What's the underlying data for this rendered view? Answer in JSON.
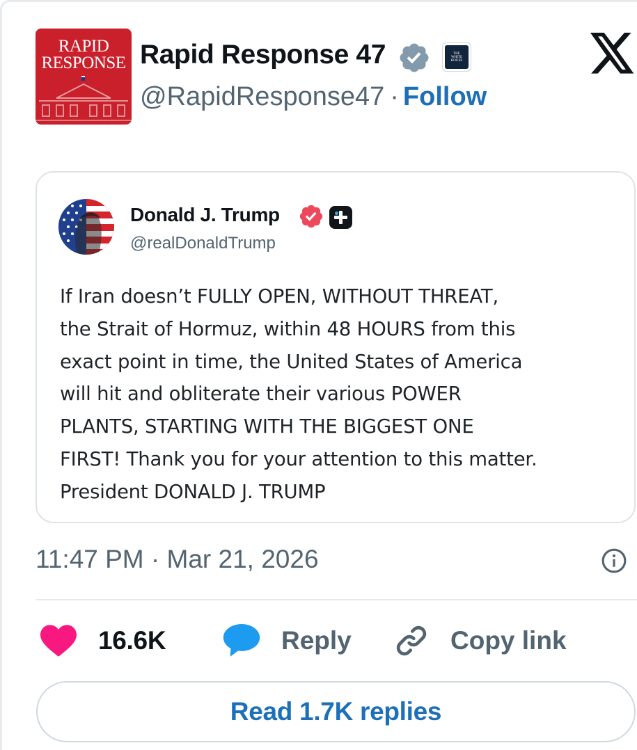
{
  "post": {
    "author": {
      "name": "Rapid Response 47",
      "handle": "@RapidResponse47",
      "avatar_text_line1": "RAPID",
      "avatar_text_line2": "RESPONSE",
      "avatar_icon": "white-house-logo",
      "verified_icon": "verified-badge-gray",
      "affiliation_icon": "white-house-badge",
      "affiliation_seal_text": "THE WHITE HOUSE"
    },
    "separator": "·",
    "follow_label": "Follow",
    "platform_icon": "x-logo",
    "quoted": {
      "name": "Donald J. Trump",
      "handle": "@realDonaldTrump",
      "verified_icon": "verified-badge-red",
      "platform_badge_icon": "truth-social-plus-icon",
      "text": "If Iran doesn’t FULLY OPEN, WITHOUT THREAT,\nthe Strait of Hormuz, within 48 HOURS from this\nexact point in time, the United States of America\nwill hit and obliterate their various POWER\nPLANTS, STARTING WITH THE BIGGEST ONE\nFIRST! Thank you for your attention to this matter.\nPresident DONALD J. TRUMP"
    },
    "timestamp": "11:47 PM · Mar 21, 2026",
    "actions": {
      "likes": "16.6K",
      "reply_label": "Reply",
      "copy_label": "Copy link"
    },
    "read_replies_label": "Read 1.7K replies"
  },
  "colors": {
    "accent_blue": "#1d6fb8",
    "like_pink": "#f91880",
    "reply_blue": "#1d9bf0",
    "avatar_red": "#c9202b",
    "muted_text": "#536471"
  }
}
